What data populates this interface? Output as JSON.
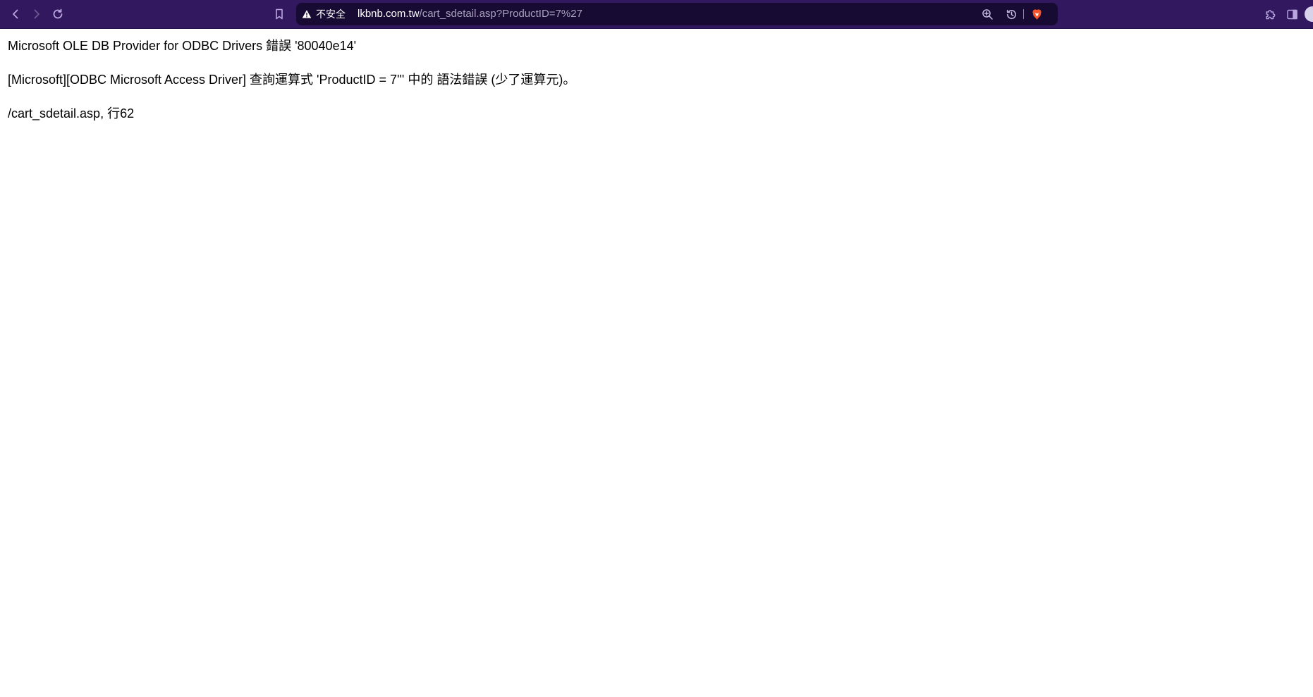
{
  "browser": {
    "security_label": "不安全",
    "url_host": "lkbnb.com.tw",
    "url_path": "/cart_sdetail.asp?ProductID=7%27",
    "icons": {
      "back": "chevron-left-icon",
      "forward": "chevron-right-icon",
      "reload": "reload-icon",
      "bookmark": "bookmark-icon",
      "warning": "warning-icon",
      "zoom": "zoom-in-icon",
      "history": "history-icon",
      "brave": "brave-lion-icon",
      "extensions": "puzzle-icon",
      "sidebar": "sidebar-icon"
    },
    "colors": {
      "toolbar": "#32195f",
      "url_bar": "#170a33",
      "url_path": "#a9a2bf",
      "brave_orange": "#fb542b"
    }
  },
  "page": {
    "error_title": "Microsoft OLE DB Provider for ODBC Drivers 錯誤 '80040e14'",
    "error_message": "[Microsoft][ODBC Microsoft Access Driver] 查詢運算式 'ProductID = 7''' 中的 語法錯誤 (少了運算元)。",
    "error_location": "/cart_sdetail.asp, 行62"
  }
}
